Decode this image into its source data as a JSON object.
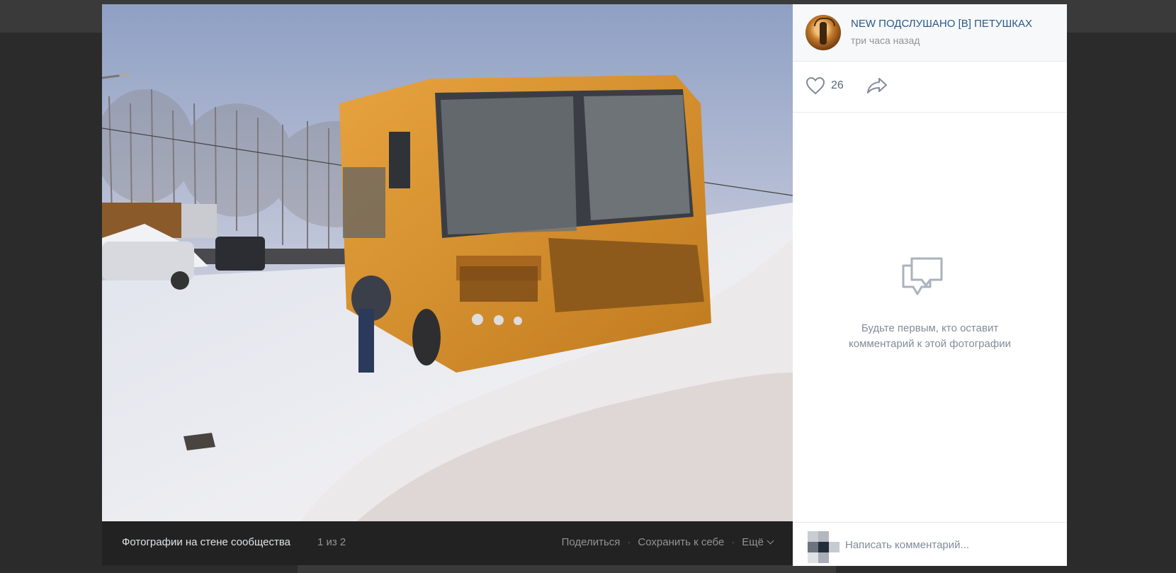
{
  "photo": {
    "alt_icon": "photo-image"
  },
  "footer": {
    "album_title": "Фотографии на стене сообщества",
    "counter": "1 из 2",
    "share_label": "Поделиться",
    "save_label": "Сохранить к себе",
    "more_label": "Ещё",
    "separator": "·"
  },
  "post": {
    "group_name": "NEW ПОДСЛУШАНО [В] ПЕТУШКАХ",
    "time": "три часа назад",
    "likes": "26",
    "like_icon": "heart-icon",
    "share_icon": "share-arrow-icon"
  },
  "comments": {
    "empty_line1": "Будьте первым, кто оставит",
    "empty_line2": "комментарий к этой фотографии",
    "empty_icon": "comments-icon",
    "input_placeholder": "Написать комментарий..."
  },
  "colors": {
    "link": "#2a5885",
    "muted": "#939393",
    "footer_bg": "#222222",
    "overlay_bg": "#2b2b2b"
  }
}
